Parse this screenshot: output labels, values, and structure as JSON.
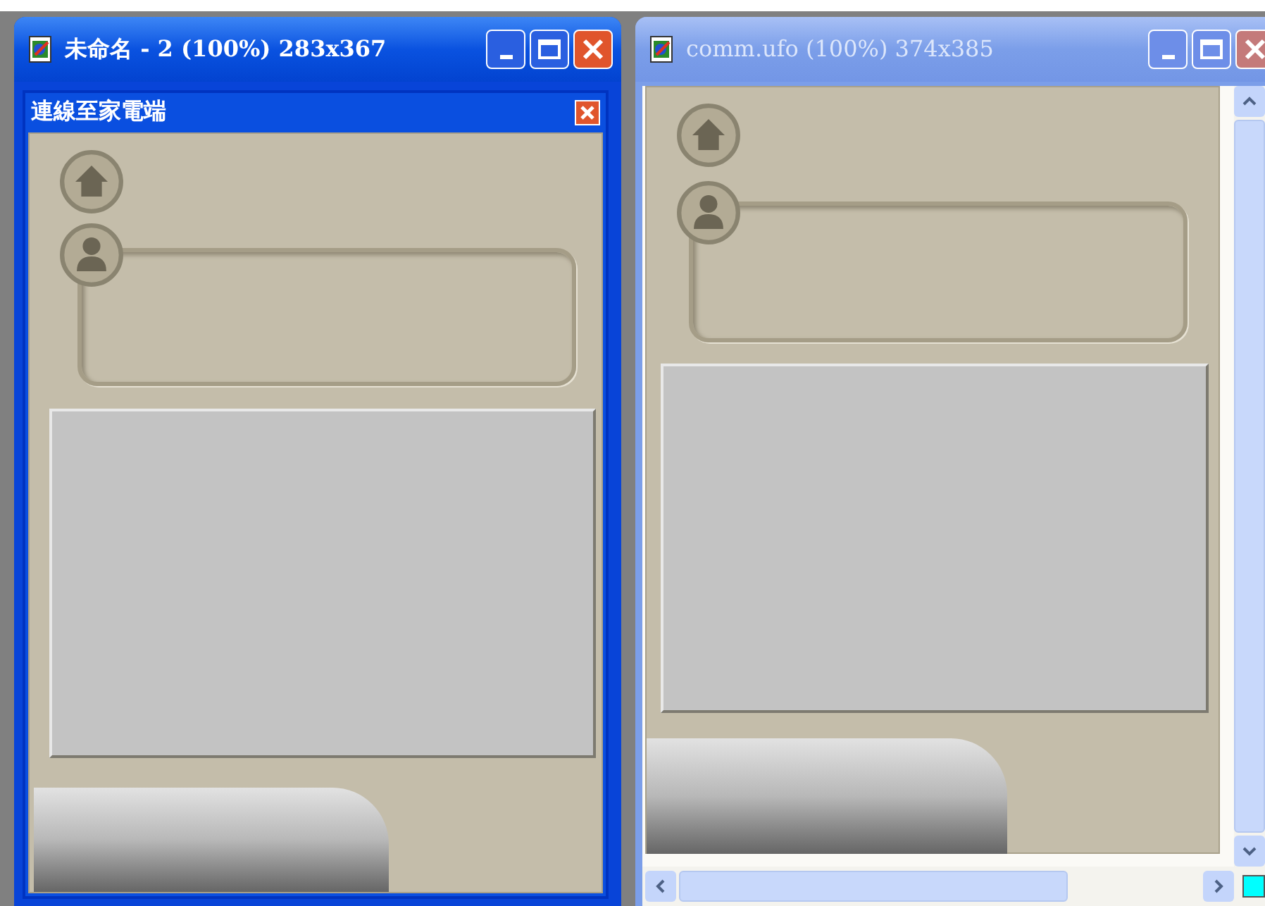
{
  "windows": [
    {
      "title": "未命名 - 2 (100%) 283x367",
      "active": true,
      "panel": {
        "title": "連線至家電端"
      }
    },
    {
      "title": "comm.ufo (100%) 374x385",
      "active": false
    }
  ]
}
